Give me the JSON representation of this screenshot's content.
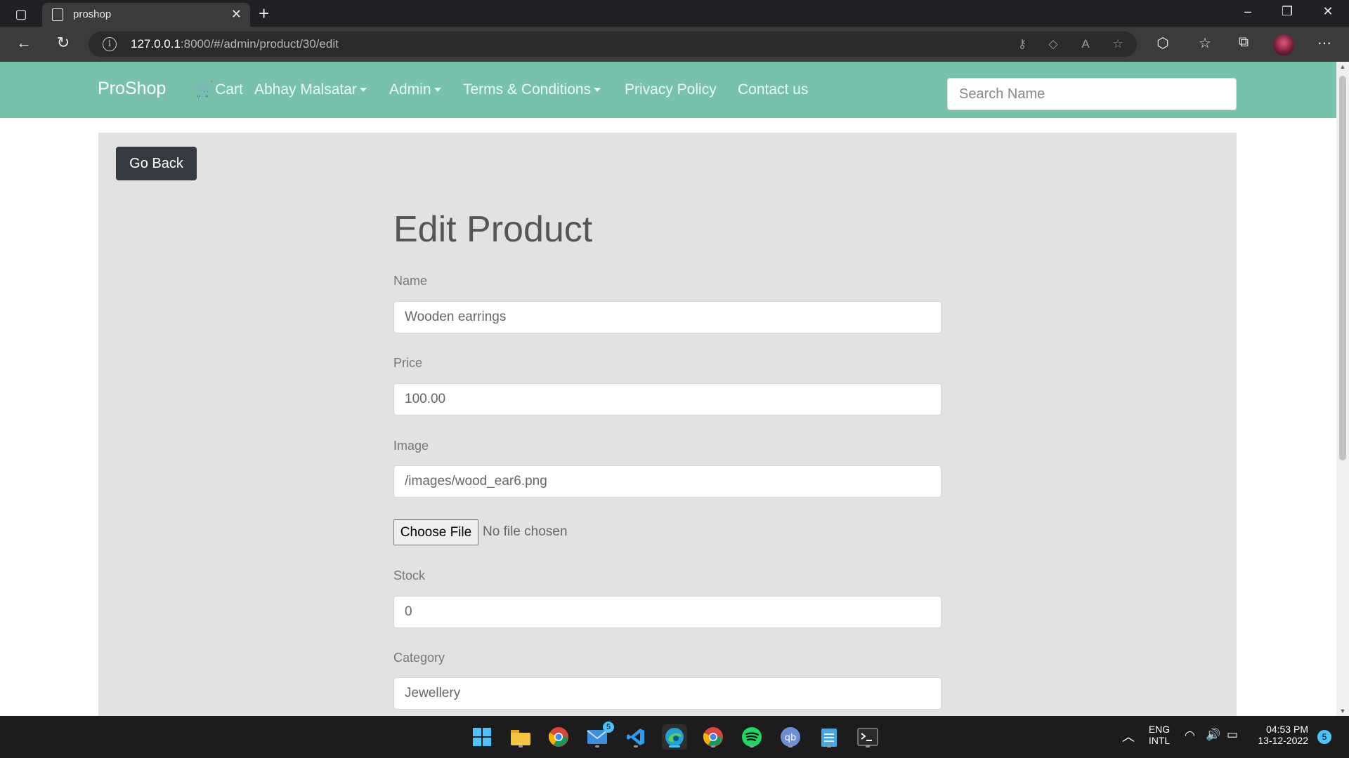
{
  "browser": {
    "tab_title": "proshop",
    "url_host": "127.0.0.1",
    "url_rest": ":8000/#/admin/product/30/edit",
    "new_tab_glyph": "+",
    "close_glyph": "✕"
  },
  "navbar": {
    "brand": "ProShop",
    "cart": "Cart",
    "user_menu": "Abhay Malsatar",
    "admin_menu": "Admin",
    "terms": "Terms & Conditions",
    "privacy": "Privacy Policy",
    "contact": "Contact us",
    "search_placeholder": "Search Name",
    "color": "#78c2ad"
  },
  "page": {
    "go_back": "Go Back",
    "title": "Edit Product",
    "fields": {
      "name_label": "Name",
      "name_value": "Wooden earrings",
      "price_label": "Price",
      "price_value": "100.00",
      "image_label": "Image",
      "image_value": "/images/wood_ear6.png",
      "file_button": "Choose File",
      "file_status": "No file chosen",
      "stock_label": "Stock",
      "stock_value": "0",
      "category_label": "Category",
      "category_value": "Jewellery"
    }
  },
  "taskbar": {
    "mail_badge": "5",
    "lang_top": "ENG",
    "lang_bottom": "INTL",
    "time": "04:53 PM",
    "date": "13-12-2022",
    "notification_count": "5",
    "apps": [
      "windows-start",
      "file-explorer",
      "chrome",
      "mail",
      "vscode",
      "edge",
      "chrome",
      "spotify",
      "qbittorrent",
      "notepad",
      "terminal"
    ]
  }
}
